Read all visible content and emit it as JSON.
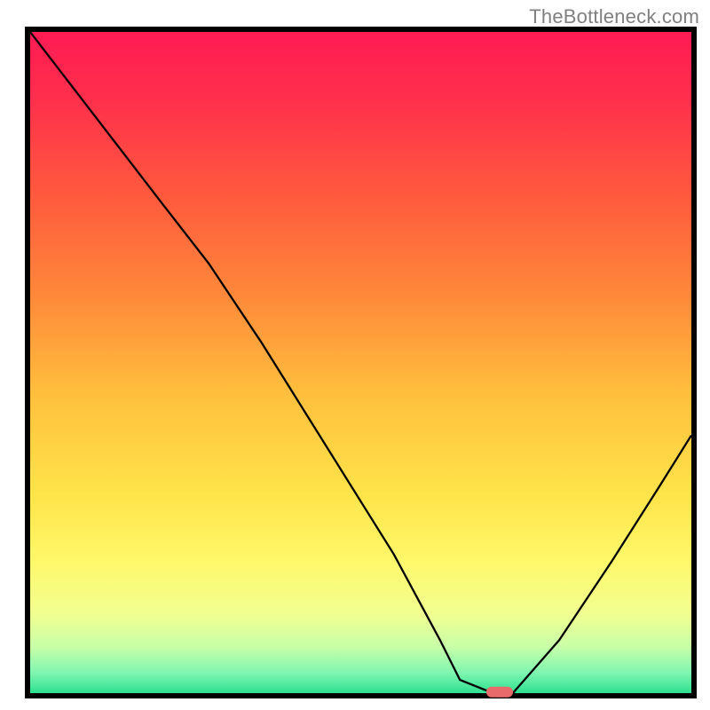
{
  "watermark": {
    "text": "TheBottleneck.com"
  },
  "colors": {
    "border": "#000000",
    "curve": "#000000",
    "marker": "#e86a6a",
    "gradient_stops": [
      {
        "offset": 0.0,
        "color": "#ff1b54"
      },
      {
        "offset": 0.1,
        "color": "#ff2f4c"
      },
      {
        "offset": 0.25,
        "color": "#ff5a3d"
      },
      {
        "offset": 0.4,
        "color": "#ff893a"
      },
      {
        "offset": 0.55,
        "color": "#ffc03d"
      },
      {
        "offset": 0.7,
        "color": "#ffe44a"
      },
      {
        "offset": 0.8,
        "color": "#fff86a"
      },
      {
        "offset": 0.88,
        "color": "#f1ff90"
      },
      {
        "offset": 0.93,
        "color": "#c8ffa8"
      },
      {
        "offset": 0.97,
        "color": "#7df5b0"
      },
      {
        "offset": 1.0,
        "color": "#2de091"
      }
    ]
  },
  "chart_data": {
    "type": "line",
    "title": "",
    "xlabel": "",
    "ylabel": "",
    "xlim": [
      0,
      100
    ],
    "ylim": [
      0,
      100
    ],
    "series": [
      {
        "name": "bottleneck-curve",
        "x": [
          0,
          10,
          20,
          27,
          35,
          45,
          55,
          62,
          65,
          70,
          73,
          80,
          88,
          95,
          100
        ],
        "y": [
          100,
          87,
          74,
          65,
          53,
          37,
          21,
          8,
          2,
          0,
          0,
          8,
          20,
          31,
          39
        ]
      }
    ],
    "marker": {
      "x": 71,
      "y": 0,
      "label": "minimum-point"
    }
  }
}
